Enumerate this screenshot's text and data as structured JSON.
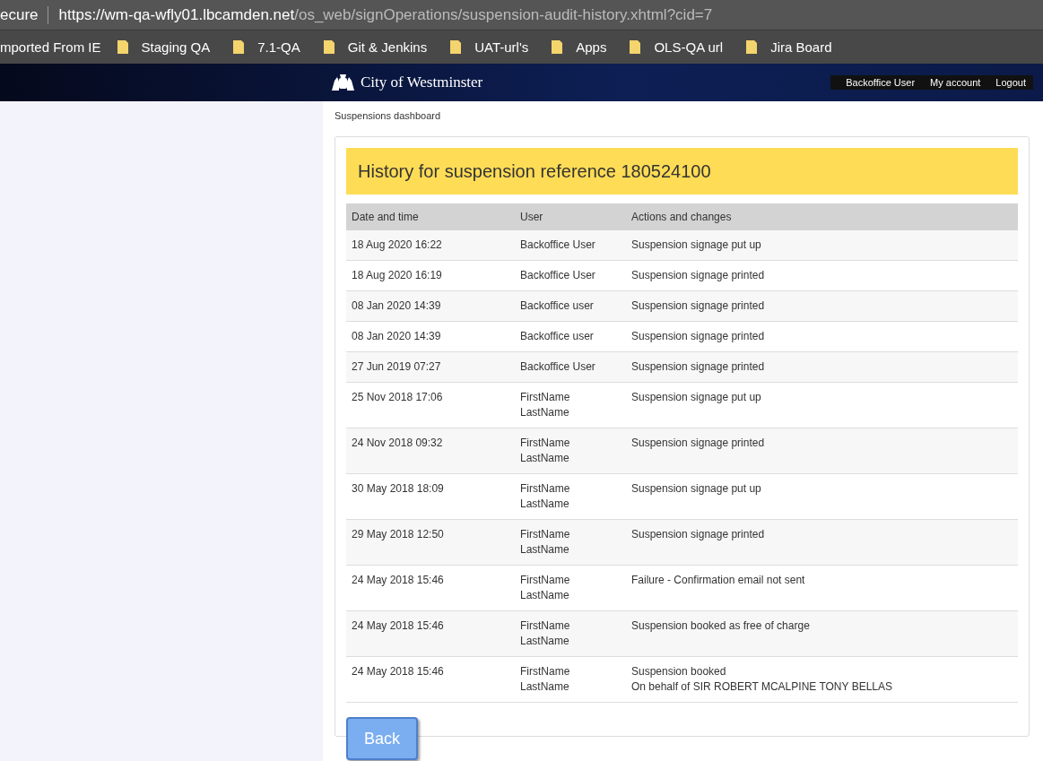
{
  "browser": {
    "security_label": "ecure",
    "url_host": "https://wm-qa-wfly01.lbcamden.net",
    "url_path": "/os_web/signOperations/suspension-audit-history.xhtml?cid=7",
    "bookmarks": [
      {
        "label": "mported From IE",
        "kind": "text"
      },
      {
        "label": "Staging QA",
        "kind": "folder"
      },
      {
        "label": "7.1-QA",
        "kind": "folder"
      },
      {
        "label": "Git & Jenkins",
        "kind": "folder"
      },
      {
        "label": "UAT-url's",
        "kind": "folder"
      },
      {
        "label": "Apps",
        "kind": "folder"
      },
      {
        "label": "OLS-QA url",
        "kind": "folder"
      },
      {
        "label": "Jira Board",
        "kind": "folder"
      }
    ]
  },
  "header": {
    "logo_text": "City of Westminster",
    "nav": [
      "Backoffice User",
      "My account",
      "Logout"
    ]
  },
  "breadcrumb": "Suspensions dashboard",
  "title": "History for suspension reference 180524100",
  "table": {
    "columns": [
      "Date and time",
      "User",
      "Actions and changes"
    ],
    "rows": [
      [
        "18 Aug 2020 16:22",
        "Backoffice User",
        "Suspension signage put up"
      ],
      [
        "18 Aug 2020 16:19",
        "Backoffice User",
        "Suspension signage printed"
      ],
      [
        "08 Jan 2020 14:39",
        "Backoffice user",
        "Suspension signage printed"
      ],
      [
        "08 Jan 2020 14:39",
        "Backoffice user",
        "Suspension signage printed"
      ],
      [
        "27 Jun 2019 07:27",
        "Backoffice User",
        "Suspension signage printed"
      ],
      [
        "25 Nov 2018 17:06",
        "FirstName\nLastName",
        "Suspension signage put up"
      ],
      [
        "24 Nov 2018 09:32",
        "FirstName\nLastName",
        "Suspension signage printed"
      ],
      [
        "30 May 2018 18:09",
        "FirstName\nLastName",
        "Suspension signage put up"
      ],
      [
        "29 May 2018 12:50",
        "FirstName\nLastName",
        "Suspension signage printed"
      ],
      [
        "24 May 2018 15:46",
        "FirstName\nLastName",
        "Failure - Confirmation email not sent"
      ],
      [
        "24 May 2018 15:46",
        "FirstName\nLastName",
        "Suspension booked as free of charge"
      ],
      [
        "24 May 2018 15:46",
        "FirstName\nLastName",
        "Suspension booked\nOn behalf of SIR ROBERT MCALPINE TONY BELLAS"
      ]
    ]
  },
  "back_button": "Back"
}
